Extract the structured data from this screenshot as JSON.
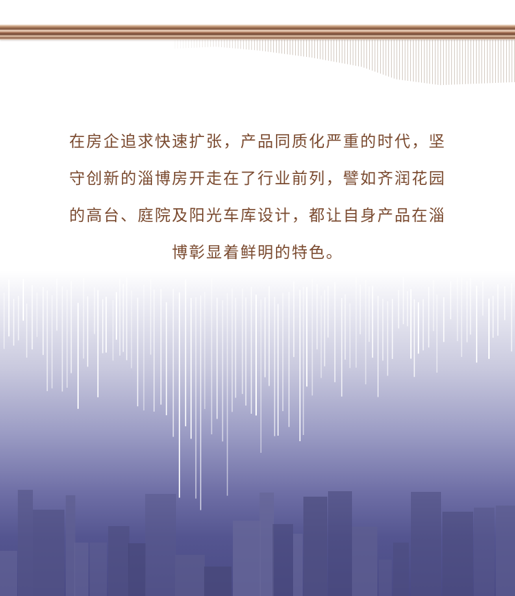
{
  "article": {
    "paragraph_lines": [
      "在房企追求快速扩张，产品同质化严重的时代，坚",
      "守创新的淄博房开走在了行业前列，譬如齐润花园",
      "的高台、庭院及阳光车库设计，都让自身产品在淄",
      "博彰显着鲜明的特色。"
    ]
  },
  "colors": {
    "text": "#7a4a2f",
    "band_dark": "#7b4f38",
    "band_light": "#f5dcc6",
    "sky_bottom": "#4a4a84"
  },
  "decor": {
    "top_band": "copper-metallic-band",
    "ribbon": "vertical-stripe-ribbon",
    "background": "white-light-lines-over-city-skyline"
  }
}
